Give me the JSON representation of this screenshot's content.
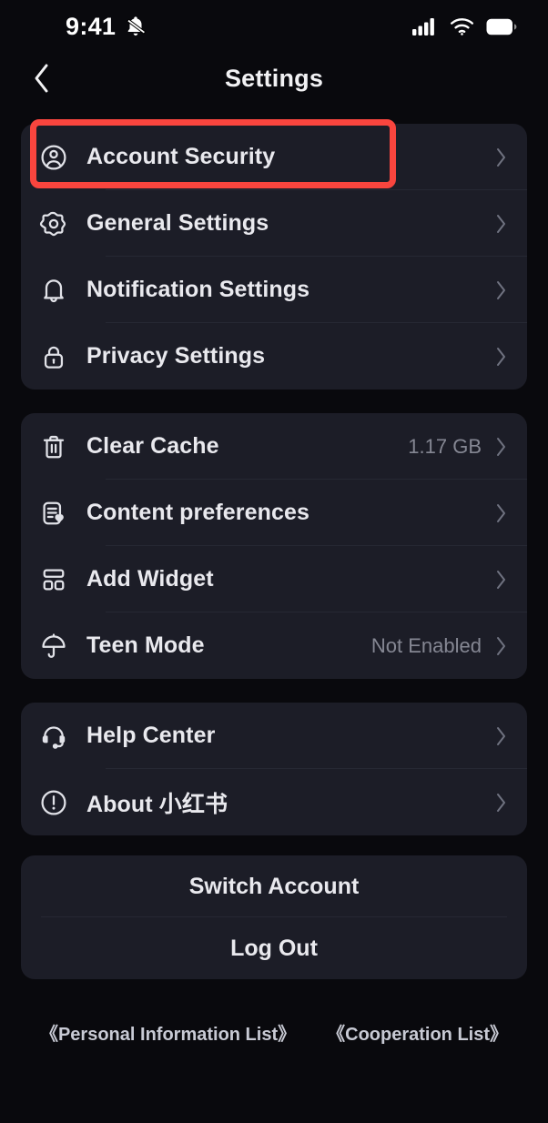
{
  "status_bar": {
    "time": "9:41",
    "silent_icon": "bell-slash-icon",
    "signal_icon": "cellular-signal-icon",
    "wifi_icon": "wifi-icon",
    "battery_icon": "battery-full-icon"
  },
  "nav": {
    "back_icon": "chevron-left-icon",
    "title": "Settings"
  },
  "sections": [
    {
      "name": "account-section",
      "rows": [
        {
          "icon": "user-circle-icon",
          "label": "Account Security",
          "value": "",
          "highlighted": true
        },
        {
          "icon": "gear-icon",
          "label": "General Settings",
          "value": ""
        },
        {
          "icon": "bell-icon",
          "label": "Notification Settings",
          "value": ""
        },
        {
          "icon": "lock-icon",
          "label": "Privacy Settings",
          "value": ""
        }
      ]
    },
    {
      "name": "content-section",
      "rows": [
        {
          "icon": "trash-icon",
          "label": "Clear Cache",
          "value": "1.17 GB"
        },
        {
          "icon": "document-heart-icon",
          "label": "Content preferences",
          "value": ""
        },
        {
          "icon": "widget-grid-icon",
          "label": "Add Widget",
          "value": ""
        },
        {
          "icon": "umbrella-icon",
          "label": "Teen Mode",
          "value": "Not Enabled"
        }
      ]
    },
    {
      "name": "support-section",
      "rows": [
        {
          "icon": "headset-icon",
          "label": "Help Center",
          "value": ""
        },
        {
          "icon": "exclamation-circle-icon",
          "label": "About 小红书",
          "value": ""
        }
      ]
    }
  ],
  "actions": [
    {
      "label": "Switch Account"
    },
    {
      "label": "Log Out"
    }
  ],
  "footer_links": [
    {
      "label": "《Personal Information List》"
    },
    {
      "label": "《Cooperation List》"
    }
  ],
  "colors": {
    "page_background": "#09090d",
    "card_background": "#1c1d27",
    "primary_text": "#e9e9ee",
    "muted_text": "#858793",
    "separator": "#262833",
    "highlight_red": "#f9453e"
  }
}
